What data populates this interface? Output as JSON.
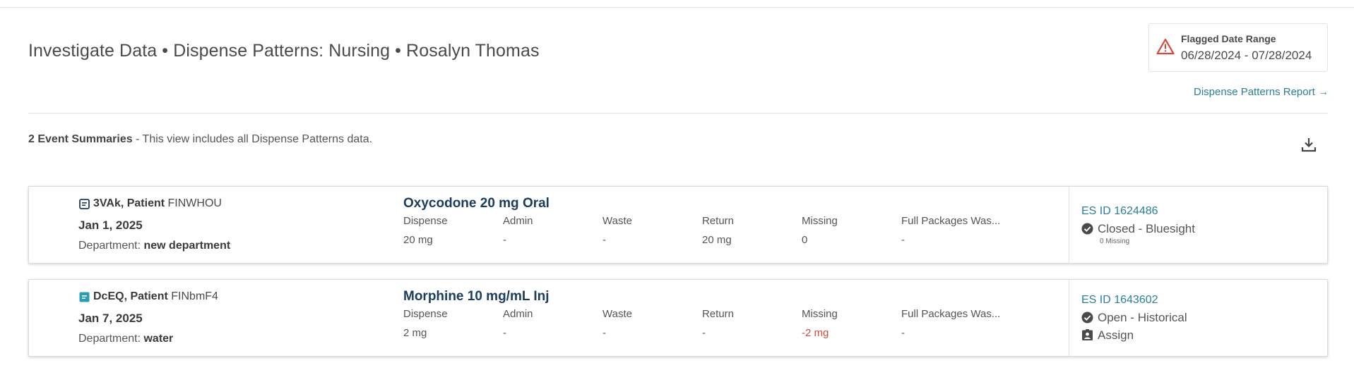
{
  "page_title": "Investigate Data • Dispense Patterns: Nursing • Rosalyn Thomas",
  "flagged_range": {
    "label": "Flagged Date Range",
    "range": "06/28/2024 - 07/28/2024",
    "icon": "warning-triangle-icon",
    "color": "#d5483a"
  },
  "report_link": {
    "label": "Dispense Patterns Report",
    "arrow": "→"
  },
  "summary": {
    "count_label": "2 Event Summaries",
    "description": " - This view includes all Dispense Patterns data."
  },
  "columns": [
    "Dispense",
    "Admin",
    "Waste",
    "Return",
    "Missing",
    "Full Packages Was..."
  ],
  "events": [
    {
      "patient_name": "3VAk, Patient",
      "patient_id": "FINWHOU",
      "date": "Jan 1, 2025",
      "department_label": "Department: ",
      "department": "new department",
      "drug": "Oxycodone 20 mg Oral",
      "values": [
        "20 mg",
        "-",
        "-",
        "20 mg",
        "0",
        "-"
      ],
      "es_id": "ES ID 1624486",
      "status": "Closed - Bluesight",
      "missing_note": "0 Missing",
      "assign": ""
    },
    {
      "patient_name": "DcEQ, Patient",
      "patient_id": "FINbmF4",
      "date": "Jan 7, 2025",
      "department_label": "Department: ",
      "department": "water",
      "drug": "Morphine 10 mg/mL Inj",
      "values": [
        "2 mg",
        "-",
        "-",
        "-",
        "-2 mg",
        "-"
      ],
      "es_id": "ES ID 1643602",
      "status": "Open - Historical",
      "missing_note": "",
      "assign": "Assign"
    }
  ],
  "colors": {
    "link": "#2a7f99",
    "drug_title": "#1b3c5c",
    "negative": "#d04a3a",
    "note_icon_1": "#1b3c5c",
    "note_icon_2": "#2a9db8"
  }
}
